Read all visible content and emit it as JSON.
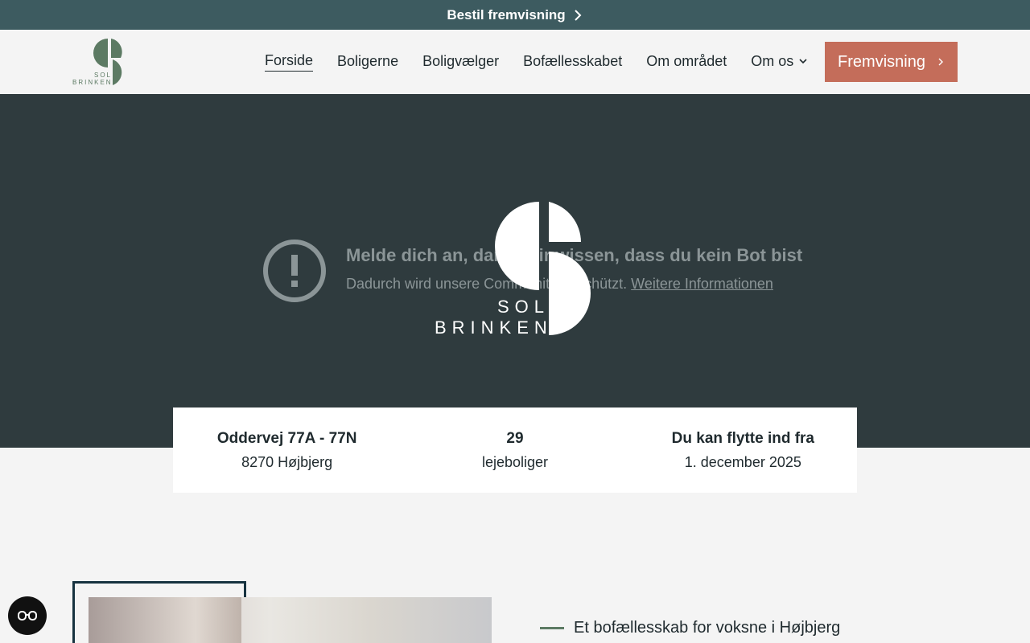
{
  "topbar": {
    "label": "Bestil fremvisning"
  },
  "header": {
    "logo_text_top": "SOL",
    "logo_text_bottom": "BRINKEN",
    "nav": [
      {
        "label": "Forside",
        "active": true
      },
      {
        "label": "Boligerne"
      },
      {
        "label": "Boligvælger"
      },
      {
        "label": "Bofællesskabet"
      },
      {
        "label": "Om området"
      },
      {
        "label": "Om os",
        "has_dropdown": true
      }
    ],
    "cta_label": "Fremvisning"
  },
  "hero": {
    "notice_title": "Melde dich an, damit wir wissen, dass du kein Bot bist",
    "notice_sub": "Dadurch wird unsere Community geschützt.",
    "notice_link": "Weitere Informationen",
    "logo_text_top": "SOL",
    "logo_text_bottom": "BRINKEN"
  },
  "facts": [
    {
      "title": "Oddervej 77A - 77N",
      "sub": "8270 Højbjerg"
    },
    {
      "title": "29",
      "sub": "lejeboliger"
    },
    {
      "title": "Du kan flytte ind fra",
      "sub": "1. december 2025"
    }
  ],
  "intro": {
    "tagline": "Et bofællesskab for voksne i Højbjerg"
  },
  "colors": {
    "topbar": "#3d5b60",
    "hero": "#2f3b3e",
    "cta": "#c46d5a",
    "logo_green": "#5c7a63"
  }
}
